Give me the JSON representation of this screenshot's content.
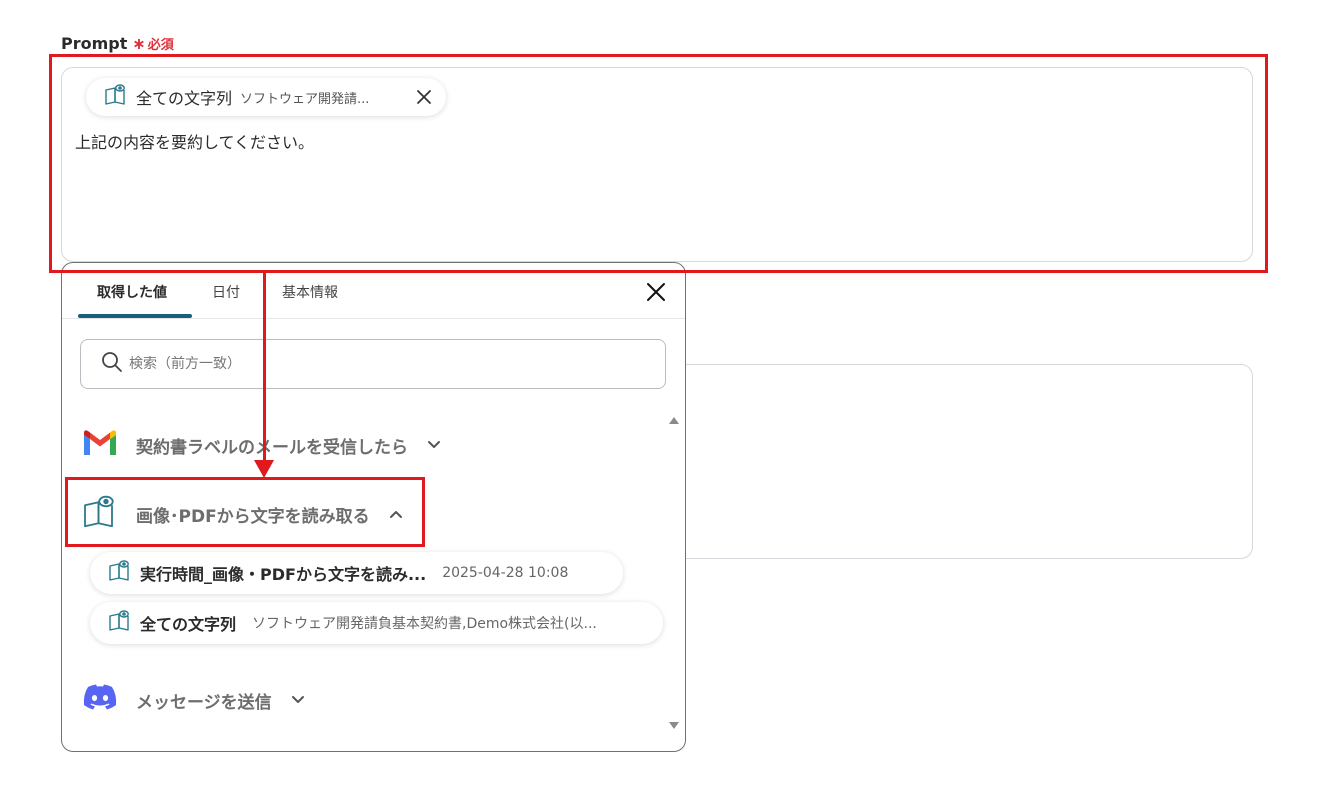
{
  "field": {
    "label": "Prompt",
    "required_star": "∗",
    "required_text": "必須"
  },
  "prompt": {
    "chip_name": "全ての文字列",
    "chip_value": "ソフトウェア開発請...",
    "body_text": "上記の内容を要約してください。"
  },
  "panel": {
    "tabs": [
      {
        "label": "取得した値",
        "active": true
      },
      {
        "label": "日付",
        "active": false
      },
      {
        "label": "基本情報",
        "active": false
      }
    ],
    "search_placeholder": "検索（前方一致）",
    "sections": [
      {
        "label": "契約書ラベルのメールを受信したら",
        "icon": "gmail-icon",
        "expanded": false
      },
      {
        "label": "画像･PDFから文字を読み取る",
        "icon": "ocr-book-icon",
        "expanded": true
      },
      {
        "label": "メッセージを送信",
        "icon": "discord-icon",
        "expanded": false
      }
    ],
    "results": [
      {
        "name": "実行時間_画像・PDFから文字を読み...",
        "value": "2025-04-28 10:08"
      },
      {
        "name": "全ての文字列",
        "value": "ソフトウェア開発請負基本契約書,Demo株式会社(以..."
      }
    ]
  },
  "colors": {
    "annotation": "#e0191f",
    "tab_accent": "#1a5f7a",
    "required": "#e0323a",
    "ocr_icon": "#2a7a8c",
    "discord": "#5865F2"
  }
}
